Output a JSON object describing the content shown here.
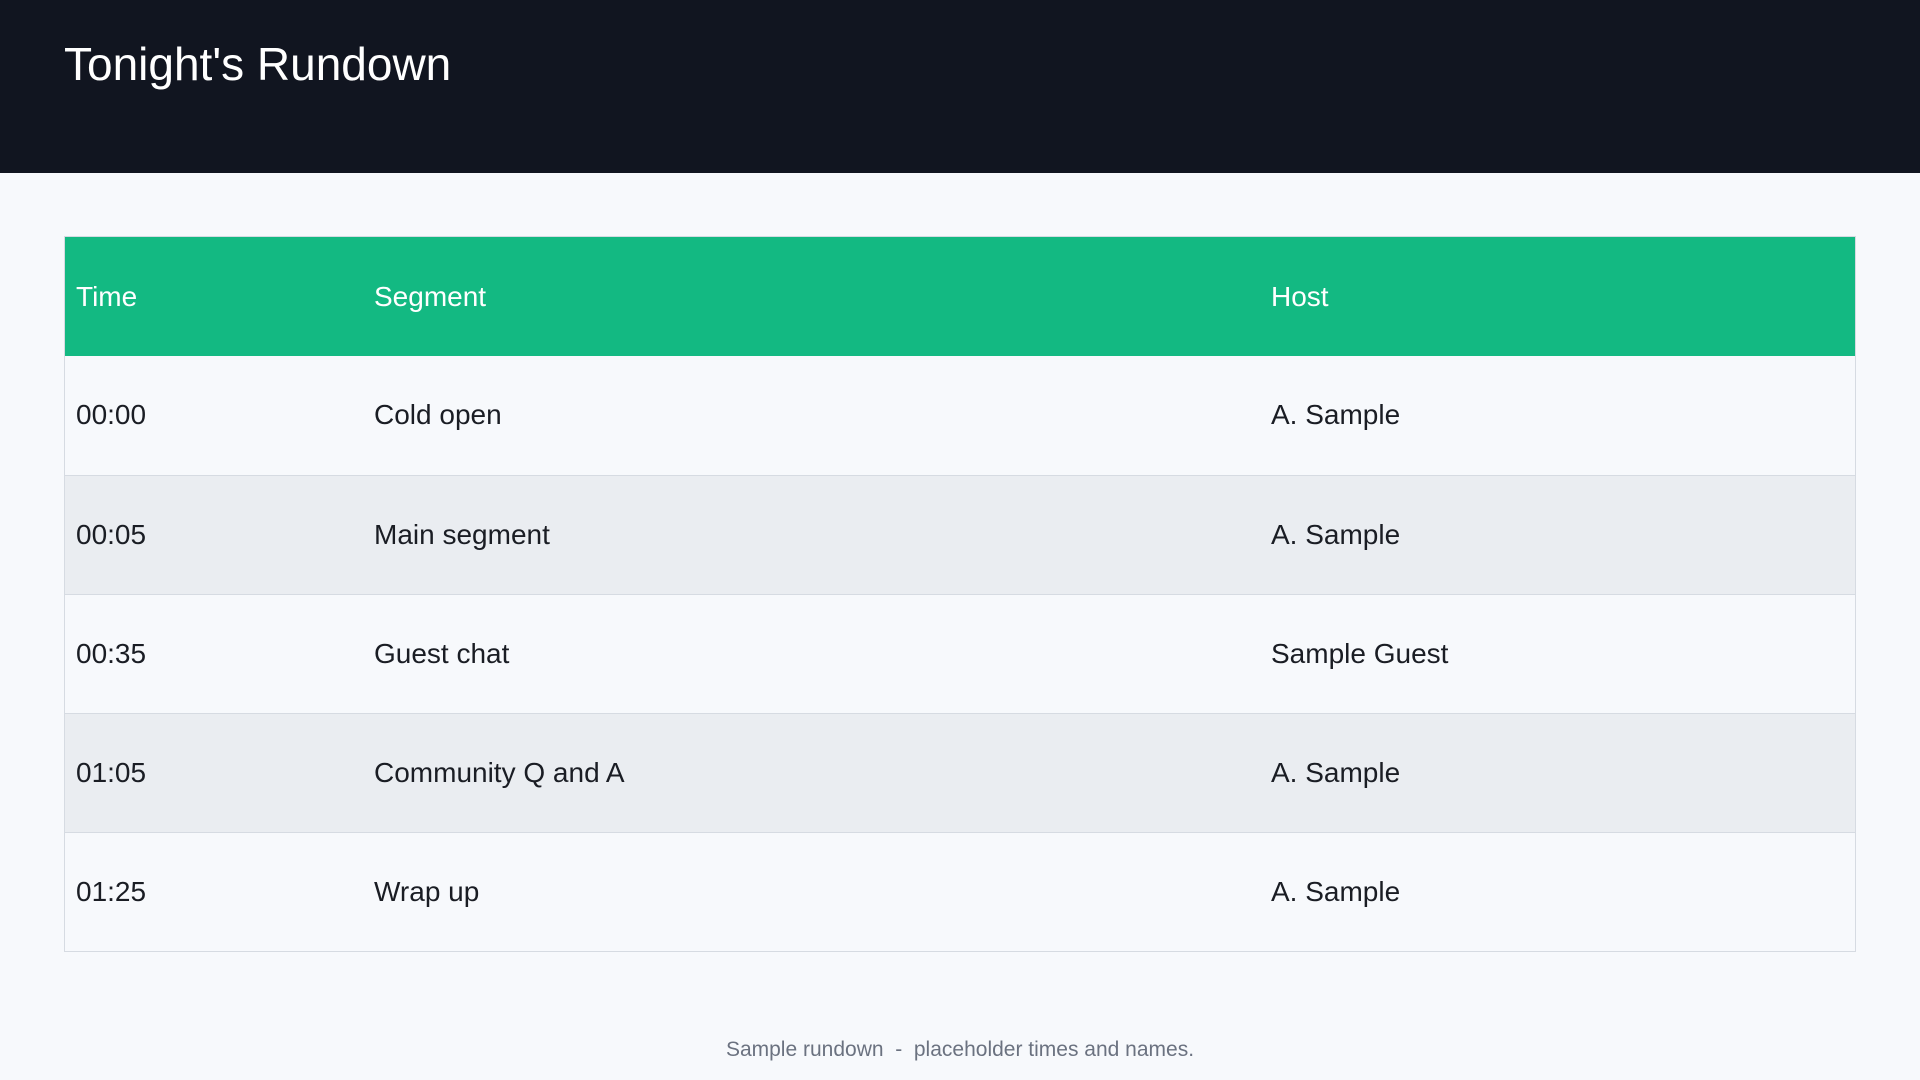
{
  "header": {
    "title": "Tonight's Rundown"
  },
  "table": {
    "columns": [
      "Time",
      "Segment",
      "Host"
    ],
    "rows": [
      {
        "time": "00:00",
        "segment": "Cold open",
        "host": "A. Sample"
      },
      {
        "time": "00:05",
        "segment": "Main segment",
        "host": "A. Sample"
      },
      {
        "time": "00:35",
        "segment": "Guest chat",
        "host": "Sample Guest"
      },
      {
        "time": "01:05",
        "segment": "Community Q and A",
        "host": "A. Sample"
      },
      {
        "time": "01:25",
        "segment": "Wrap up",
        "host": "A. Sample"
      }
    ]
  },
  "footer": {
    "text": "Sample rundown  -  placeholder times and names."
  },
  "colors": {
    "header_bg": "#111520",
    "table_header_bg": "#13b982",
    "row_alt_bg": "#eaedf1",
    "page_bg": "#f7f9fc"
  }
}
